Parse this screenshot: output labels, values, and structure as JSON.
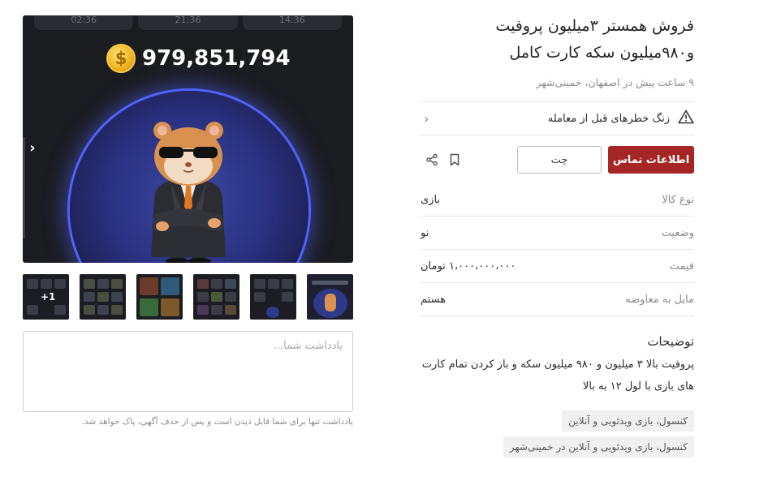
{
  "ad": {
    "title_line1": "فروش همستر ۳میلیون پروفیت",
    "title_line2": "و۹۸۰میلیون سکه کارت کامل",
    "meta": "۹ ساعت پیش در اصفهان، خمینی‌شهر",
    "warning": "زنگ خطرهای قبل از معامله"
  },
  "actions": {
    "contact_label": "اطلاعات تماس",
    "chat_label": "چت"
  },
  "details": [
    {
      "key": "نوع کالا",
      "value": "بازی"
    },
    {
      "key": "وضعیت",
      "value": "نو"
    },
    {
      "key": "قیمت",
      "value": "۱،۰۰۰،۰۰۰،۰۰۰ تومان"
    },
    {
      "key": "مایل به معاوضه",
      "value": "هستم"
    }
  ],
  "description": {
    "title": "توضیحات",
    "line1": "پروفیت بالا ۳ میلیون و ۹۸۰ میلیون سکه و باز کردن تمام کارت",
    "line2": "های بازی با لول ۱۲ به بالا"
  },
  "tags": [
    "کنسول، بازی ویدئویی و آنلاین",
    "کنسول، بازی ویدئویی و آنلاین در خمینی‌شهر"
  ],
  "gallery": {
    "time_tabs": [
      "02:36",
      "21:36",
      "14:36"
    ],
    "coins": "979,851,794",
    "coin_symbol": "$",
    "more_label": "+1"
  },
  "note": {
    "placeholder": "یادداشت شما...",
    "hint": "یادداشت تنها برای شما قابل دیدن است و پس از حذف آگهی، پاک خواهد شد."
  },
  "icons": {
    "warning": "warning-triangle-icon",
    "chevron": "chevron-left-icon",
    "bookmark": "bookmark-icon",
    "share": "share-icon"
  },
  "colors": {
    "primary": "#a62626",
    "hero_bg": "#1b1c20",
    "glow": "#4f63ff",
    "coin": "#f0b21e"
  }
}
